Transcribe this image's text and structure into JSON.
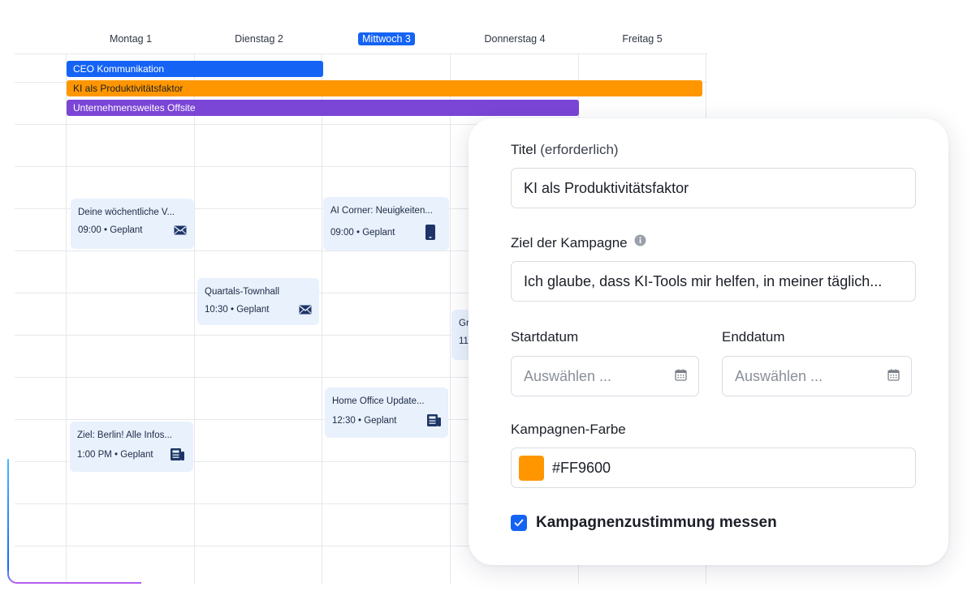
{
  "calendar": {
    "days": [
      {
        "label": "Montag 1",
        "active": false
      },
      {
        "label": "Dienstag 2",
        "active": false
      },
      {
        "label": "Mittwoch 3",
        "active": true
      },
      {
        "label": "Donnerstag 4",
        "active": false
      },
      {
        "label": "Freitag 5",
        "active": false
      }
    ],
    "campaigns": [
      {
        "label": "CEO Kommunikation",
        "color": "#1463F5",
        "text_color": "#FFFFFF"
      },
      {
        "label": "KI als Produktivitätsfaktor",
        "color": "#FF9600",
        "text_color": "#1B1F27"
      },
      {
        "label": "Unternehmensweites Offsite",
        "color": "#7B45D6",
        "text_color": "#FFFFFF"
      }
    ],
    "events": [
      {
        "title": "Deine wöchentliche V...",
        "time": "09:00",
        "status": "Geplant",
        "icon": "mail-icon"
      },
      {
        "title": "AI Corner: Neuigkeiten...",
        "time": "09:00",
        "status": "Geplant",
        "icon": "mobile-icon"
      },
      {
        "title": "Quartals-Townhall",
        "time": "10:30",
        "status": "Geplant",
        "icon": "mail-icon"
      },
      {
        "title": "Gr",
        "time": "11",
        "status": "",
        "icon": ""
      },
      {
        "title": "Home Office Update...",
        "time": "12:30",
        "status": "Geplant",
        "icon": "newspaper-icon"
      },
      {
        "title": "Ziel: Berlin! Alle Infos...",
        "time": "1:00 PM",
        "status": "Geplant",
        "icon": "newspaper-icon"
      }
    ],
    "meta_separator": "•"
  },
  "form": {
    "title_label": "Titel",
    "title_required": "(erforderlich)",
    "title_value": "KI als Produktivitätsfaktor",
    "goal_label": "Ziel der Kampagne",
    "goal_value": "Ich glaube, dass KI-Tools mir helfen, in meiner täglich...",
    "start_label": "Startdatum",
    "start_placeholder": "Auswählen ...",
    "end_label": "Enddatum",
    "end_placeholder": "Auswählen ...",
    "color_label": "Kampagnen-Farbe",
    "color_value": "#FF9600",
    "color_swatch": "#FF9600",
    "consent_label": "Kampagnenzustimmung messen",
    "consent_checked": true
  },
  "colors": {
    "accent": "#1463F5",
    "event_card_bg": "#E9F1FD",
    "event_text": "#1D2A44"
  }
}
